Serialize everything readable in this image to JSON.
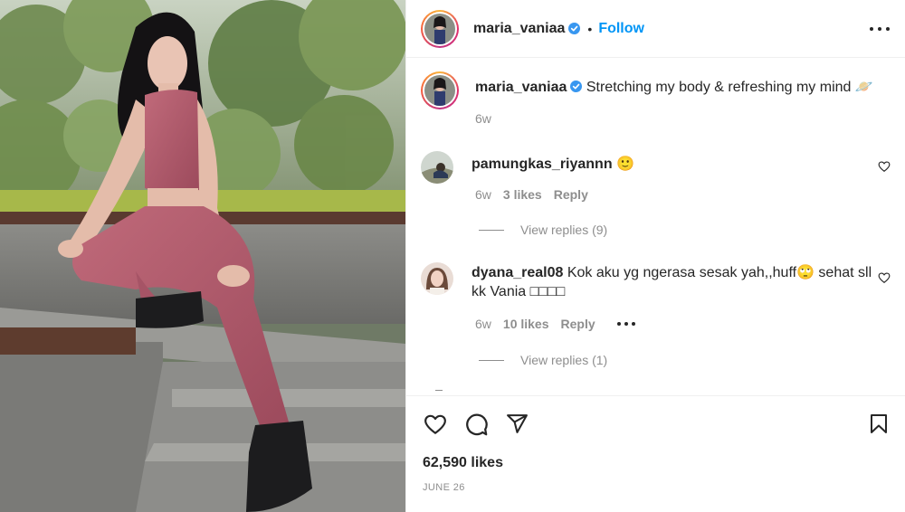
{
  "post": {
    "author": "maria_vaniaa",
    "follow_label": "Follow",
    "separator": "•",
    "caption": {
      "username": "maria_vaniaa",
      "text": "Stretching my body & refreshing my mind 🪐",
      "time": "6w"
    },
    "likes_label": "62,590 likes",
    "date_label": "JUNE 26"
  },
  "comments": [
    {
      "username": "pamungkas_riyannn",
      "text": "🙂",
      "time": "6w",
      "likes": "3 likes",
      "reply_label": "Reply",
      "view_replies": "View replies (9)"
    },
    {
      "username": "dyana_real08",
      "text": "Kok aku yg ngerasa sesak yah,,huff🙄 sehat sll",
      "text_line2": "kk Vania □□□□",
      "time": "6w",
      "likes": "10 likes",
      "reply_label": "Reply",
      "view_replies": "View replies (1)"
    }
  ],
  "icons": {
    "verified": "verified-badge-icon",
    "more": "more-options-icon",
    "like": "heart-icon",
    "comment": "comment-icon",
    "share": "share-icon",
    "save": "bookmark-icon"
  },
  "colors": {
    "accent": "#0095f6",
    "text": "#262626",
    "muted": "#8e8e8e",
    "verified": "#3897f0",
    "outfit": "#b2586a"
  }
}
